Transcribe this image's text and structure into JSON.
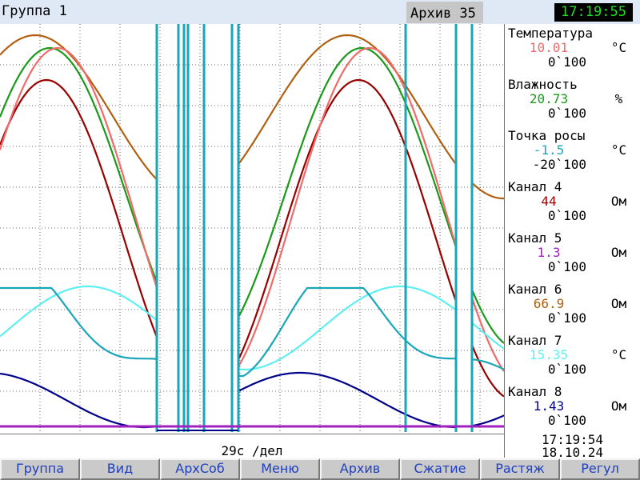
{
  "header": {
    "group_title": "Группа 1",
    "archive_label": "Архив 35",
    "clock": "17:19:55"
  },
  "plot": {
    "scale_label": "29с /дел",
    "colors": {
      "grid": "#666666",
      "marker": "#1aa6b8",
      "baseline": "#a020c0"
    }
  },
  "channels": [
    {
      "name": "Температура",
      "value": "10.01",
      "unit": "°C",
      "range": "0`100",
      "color": "#f06a6a"
    },
    {
      "name": "Влажность",
      "value": "20.73",
      "unit": "%",
      "range": "0`100",
      "color": "#1a9a1a"
    },
    {
      "name": "Точка росы",
      "value": "-1.5",
      "unit": "°C",
      "range": "-20`100",
      "color": "#1aa6b8"
    },
    {
      "name": "Канал 4",
      "value": "44",
      "unit": "Ом",
      "range": "0`100",
      "color": "#990000"
    },
    {
      "name": "Канал 5",
      "value": "1.3",
      "unit": "Ом",
      "range": "0`100",
      "color": "#a020c0"
    },
    {
      "name": "Канал 6",
      "value": "66.9",
      "unit": "Ом",
      "range": "0`100",
      "color": "#b06010"
    },
    {
      "name": "Канал 7",
      "value": "15.35",
      "unit": "°C",
      "range": "0`100",
      "color": "#5ef0f0"
    },
    {
      "name": "Канал 8",
      "value": "1.43",
      "unit": "Ом",
      "range": "0`100",
      "color": "#00008b"
    }
  ],
  "side_time": "17:19:54",
  "side_date": "18.10.24",
  "menu": [
    "Группа",
    "Вид",
    "АрхСоб",
    "Меню",
    "Архив",
    "Сжатие",
    "Растяж",
    "Регул"
  ]
}
